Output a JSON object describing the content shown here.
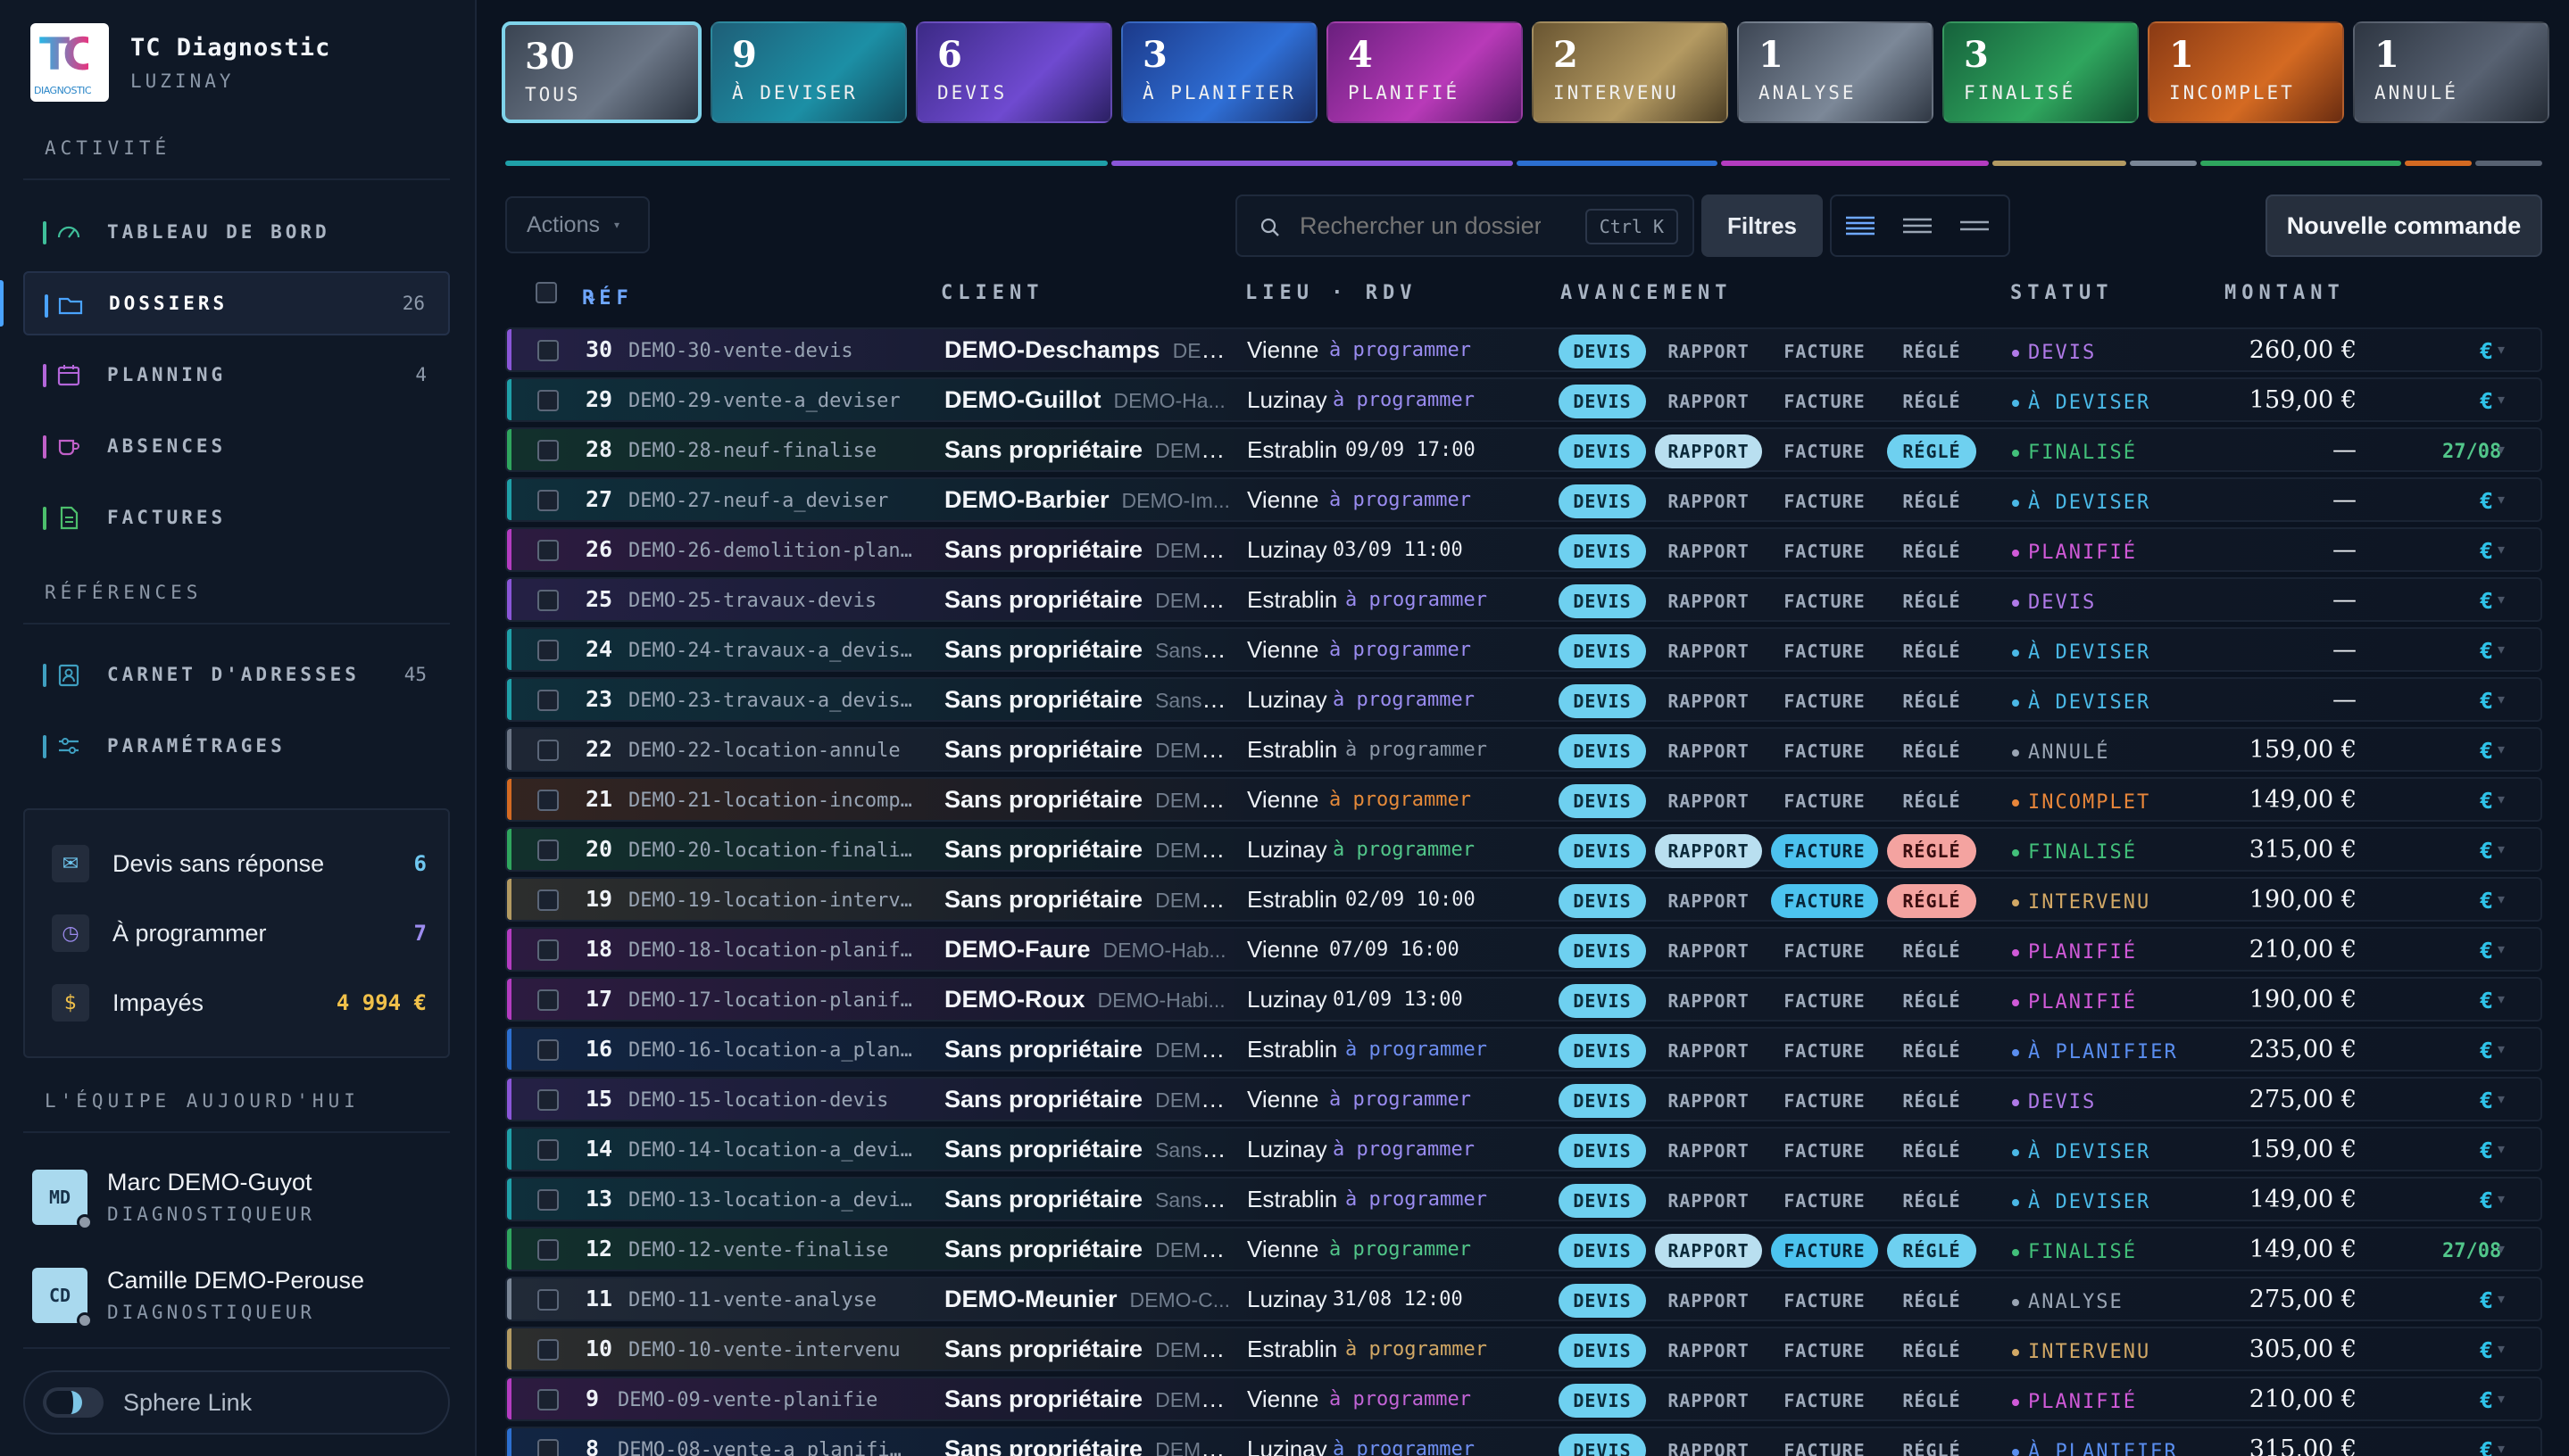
{
  "brand": {
    "title": "TC Diagnostic",
    "city": "LUZINAY",
    "logo_text": "TC",
    "logo_sub": "DIAGNOSTIC"
  },
  "sidebar": {
    "section_activite": "ACTIVITÉ",
    "nav": [
      {
        "label": "TABLEAU DE BORD",
        "count": "",
        "color": "#3fbf9a",
        "icon": "gauge-icon"
      },
      {
        "label": "DOSSIERS",
        "count": "26",
        "color": "#4aa3ff",
        "icon": "folder-icon"
      },
      {
        "label": "PLANNING",
        "count": "4",
        "color": "#b366d9",
        "icon": "calendar-icon"
      },
      {
        "label": "ABSENCES",
        "count": "",
        "color": "#c060c8",
        "icon": "mug-icon"
      },
      {
        "label": "FACTURES",
        "count": "",
        "color": "#4cbf6c",
        "icon": "document-icon"
      }
    ],
    "section_refs": "RÉFÉRENCES",
    "refs": [
      {
        "label": "CARNET D'ADRESSES",
        "count": "45",
        "color": "#3f9fc0",
        "icon": "contacts-icon"
      },
      {
        "label": "PARAMÉTRAGES",
        "count": "",
        "color": "#3f9fc0",
        "icon": "sliders-icon"
      }
    ],
    "stats": [
      {
        "label": "Devis sans réponse",
        "value": "6",
        "color": "#6fc7f0",
        "icon": "mail-icon"
      },
      {
        "label": "À programmer",
        "value": "7",
        "color": "#9d8cf0",
        "icon": "clock-icon"
      },
      {
        "label": "Impayés",
        "value": "4 994 €",
        "color": "#f0c04a",
        "icon": "coin-icon"
      }
    ],
    "section_team": "L'ÉQUIPE AUJOURD'HUI",
    "team": [
      {
        "initials": "MD",
        "name": "Marc DEMO-Guyot",
        "role": "DIAGNOSTIQUEUR"
      },
      {
        "initials": "CD",
        "name": "Camille DEMO-Perouse",
        "role": "DIAGNOSTIQUEUR"
      }
    ],
    "sphere_label": "Sphere Link"
  },
  "cards": [
    {
      "count": "30",
      "label": "TOUS",
      "bg": "linear-gradient(135deg,#3a4452,#6b7686 60%,#2c3440)"
    },
    {
      "count": "9",
      "label": "À DEVISER",
      "bg": "linear-gradient(135deg,#1e5f78,#1c8fa5 60%,#124a5c)"
    },
    {
      "count": "6",
      "label": "DEVIS",
      "bg": "linear-gradient(135deg,#3c2a86,#6f4ad0 60%,#2b2063)"
    },
    {
      "count": "3",
      "label": "À PLANIFIER",
      "bg": "linear-gradient(135deg,#1c3a8a,#2f6fd6 60%,#1a2e66)"
    },
    {
      "count": "4",
      "label": "PLANIFIÉ",
      "bg": "linear-gradient(135deg,#6a1f7e,#b83ab8 60%,#541a66)"
    },
    {
      "count": "2",
      "label": "INTERVENU",
      "bg": "linear-gradient(135deg,#6a5632,#b49a62 60%,#4c3e24)"
    },
    {
      "count": "1",
      "label": "ANALYSE",
      "bg": "linear-gradient(135deg,#3d4654,#7c8898 60%,#2f3743)"
    },
    {
      "count": "3",
      "label": "FINALISÉ",
      "bg": "linear-gradient(135deg,#16623c,#2fa65e 60%,#124e30)"
    },
    {
      "count": "1",
      "label": "INCOMPLET",
      "bg": "linear-gradient(135deg,#8a3a14,#d46a22 60%,#6a2c10)"
    },
    {
      "count": "1",
      "label": "ANNULÉ",
      "bg": "linear-gradient(135deg,#2e3642,#586272 60%,#242b35)"
    }
  ],
  "progress": [
    {
      "w": 9,
      "color": "#1fa0a8"
    },
    {
      "w": 6,
      "color": "#8a56d8"
    },
    {
      "w": 3,
      "color": "#2c6fd0"
    },
    {
      "w": 4,
      "color": "#b43cc0"
    },
    {
      "w": 2,
      "color": "#b39a62"
    },
    {
      "w": 1,
      "color": "#7a8696"
    },
    {
      "w": 3,
      "color": "#2fa65e"
    },
    {
      "w": 1,
      "color": "#d46a22"
    },
    {
      "w": 1,
      "color": "#586272"
    }
  ],
  "toolbar": {
    "actions": "Actions",
    "search_placeholder": "Rechercher un dossier",
    "shortcut": "Ctrl K",
    "filters": "Filtres",
    "new_order": "Nouvelle commande"
  },
  "columns": {
    "ref": "RÉF",
    "client": "CLIENT",
    "lieu": "LIEU · RDV",
    "avancement": "AVANCEMENT",
    "statut": "STATUT",
    "montant": "MONTANT"
  },
  "pill_labels": {
    "devis": "DEVIS",
    "rapport": "RAPPORT",
    "facture": "FACTURE",
    "regle": "RÉGLÉ"
  },
  "rows": [
    {
      "n": "30",
      "ref": "DEMO-30-vente-devis",
      "client": "DEMO-Deschamps",
      "sub": "DEMO-...",
      "lieu": "Vienne",
      "rdv": "à programmer",
      "rdvc": "#9a8cf0",
      "st": "DEVIS",
      "stc": "#b07ae8",
      "amt": "260,00 €",
      "extra": "€",
      "rapport": 0,
      "facture": 0,
      "regle": 0,
      "acc": "#8a56d8"
    },
    {
      "n": "29",
      "ref": "DEMO-29-vente-a_deviser",
      "client": "DEMO-Guillot",
      "sub": "DEMO-Ha...",
      "lieu": "Luzinay",
      "rdv": "à programmer",
      "rdvc": "#9a8cf0",
      "st": "À DEVISER",
      "stc": "#4ab8e6",
      "amt": "159,00 €",
      "extra": "€",
      "rapport": 0,
      "facture": 0,
      "regle": 0,
      "acc": "#1fa0a8"
    },
    {
      "n": "28",
      "ref": "DEMO-28-neuf-finalise",
      "client": "Sans propriétaire",
      "sub": "DEMO-...",
      "lieu": "Estrablin",
      "rdv": "09/09 17:00",
      "rdvc": "#e9edf3",
      "st": "FINALISÉ",
      "stc": "#42c07a",
      "amt": "—",
      "extra": "27/08",
      "rapport": 1,
      "facture": 0,
      "regle": 1,
      "acc": "#2fa65e"
    },
    {
      "n": "27",
      "ref": "DEMO-27-neuf-a_deviser",
      "client": "DEMO-Barbier",
      "sub": "DEMO-Im...",
      "lieu": "Vienne",
      "rdv": "à programmer",
      "rdvc": "#9a8cf0",
      "st": "À DEVISER",
      "stc": "#4ab8e6",
      "amt": "—",
      "extra": "€",
      "rapport": 0,
      "facture": 0,
      "regle": 0,
      "acc": "#1fa0a8"
    },
    {
      "n": "26",
      "ref": "DEMO-26-demolition-planifie",
      "client": "Sans propriétaire",
      "sub": "DEMO-...",
      "lieu": "Luzinay",
      "rdv": "03/09 11:00",
      "rdvc": "#e9edf3",
      "st": "PLANIFIÉ",
      "stc": "#d05ad8",
      "amt": "—",
      "extra": "€",
      "rapport": 0,
      "facture": 0,
      "regle": 0,
      "acc": "#b43cc0"
    },
    {
      "n": "25",
      "ref": "DEMO-25-travaux-devis",
      "client": "Sans propriétaire",
      "sub": "DEMO-...",
      "lieu": "Estrablin",
      "rdv": "à programmer",
      "rdvc": "#9a8cf0",
      "st": "DEVIS",
      "stc": "#b07ae8",
      "amt": "—",
      "extra": "€",
      "rapport": 0,
      "facture": 0,
      "regle": 0,
      "acc": "#8a56d8"
    },
    {
      "n": "24",
      "ref": "DEMO-24-travaux-a_deviser",
      "client": "Sans propriétaire",
      "sub": "Sans pr...",
      "lieu": "Vienne",
      "rdv": "à programmer",
      "rdvc": "#9a8cf0",
      "st": "À DEVISER",
      "stc": "#4ab8e6",
      "amt": "—",
      "extra": "€",
      "rapport": 0,
      "facture": 0,
      "regle": 0,
      "acc": "#1fa0a8"
    },
    {
      "n": "23",
      "ref": "DEMO-23-travaux-a_deviser",
      "client": "Sans propriétaire",
      "sub": "Sans pr...",
      "lieu": "Luzinay",
      "rdv": "à programmer",
      "rdvc": "#9a8cf0",
      "st": "À DEVISER",
      "stc": "#4ab8e6",
      "amt": "—",
      "extra": "€",
      "rapport": 0,
      "facture": 0,
      "regle": 0,
      "acc": "#1fa0a8"
    },
    {
      "n": "22",
      "ref": "DEMO-22-location-annule",
      "client": "Sans propriétaire",
      "sub": "DEMO-...",
      "lieu": "Estrablin",
      "rdv": "à programmer",
      "rdvc": "#8d98a8",
      "st": "ANNULÉ",
      "stc": "#9aa5b4",
      "amt": "159,00 €",
      "extra": "€",
      "rapport": 0,
      "facture": 0,
      "regle": 0,
      "acc": "#6a7484"
    },
    {
      "n": "21",
      "ref": "DEMO-21-location-incomplet",
      "client": "Sans propriétaire",
      "sub": "DEMO-...",
      "lieu": "Vienne",
      "rdv": "à programmer",
      "rdvc": "#e58a3a",
      "st": "INCOMPLET",
      "stc": "#e8863a",
      "amt": "149,00 €",
      "extra": "€",
      "rapport": 0,
      "facture": 0,
      "regle": 0,
      "acc": "#d46a22"
    },
    {
      "n": "20",
      "ref": "DEMO-20-location-finalise",
      "client": "Sans propriétaire",
      "sub": "DEMO-...",
      "lieu": "Luzinay",
      "rdv": "à programmer",
      "rdvc": "#52c68a",
      "st": "FINALISÉ",
      "stc": "#42c07a",
      "amt": "315,00 €",
      "extra": "€",
      "rapport": 1,
      "facture": 1,
      "regle": 2,
      "acc": "#2fa65e"
    },
    {
      "n": "19",
      "ref": "DEMO-19-location-intervenu",
      "client": "Sans propriétaire",
      "sub": "DEMO-...",
      "lieu": "Estrablin",
      "rdv": "02/09 10:00",
      "rdvc": "#e9edf3",
      "st": "INTERVENU",
      "stc": "#d2a865",
      "amt": "190,00 €",
      "extra": "€",
      "rapport": 0,
      "facture": 1,
      "regle": 2,
      "acc": "#b39a62"
    },
    {
      "n": "18",
      "ref": "DEMO-18-location-planifie",
      "client": "DEMO-Faure",
      "sub": "DEMO-Hab...",
      "lieu": "Vienne",
      "rdv": "07/09 16:00",
      "rdvc": "#e9edf3",
      "st": "PLANIFIÉ",
      "stc": "#d05ad8",
      "amt": "210,00 €",
      "extra": "€",
      "rapport": 0,
      "facture": 0,
      "regle": 0,
      "acc": "#b43cc0"
    },
    {
      "n": "17",
      "ref": "DEMO-17-location-planifie",
      "client": "DEMO-Roux",
      "sub": "DEMO-Habi...",
      "lieu": "Luzinay",
      "rdv": "01/09 13:00",
      "rdvc": "#e9edf3",
      "st": "PLANIFIÉ",
      "stc": "#d05ad8",
      "amt": "190,00 €",
      "extra": "€",
      "rapport": 0,
      "facture": 0,
      "regle": 0,
      "acc": "#b43cc0"
    },
    {
      "n": "16",
      "ref": "DEMO-16-location-a_planifier",
      "client": "Sans propriétaire",
      "sub": "DEMO-...",
      "lieu": "Estrablin",
      "rdv": "à programmer",
      "rdvc": "#6e8ef0",
      "st": "À PLANIFIER",
      "stc": "#5a8ef0",
      "amt": "235,00 €",
      "extra": "€",
      "rapport": 0,
      "facture": 0,
      "regle": 0,
      "acc": "#2c6fd0"
    },
    {
      "n": "15",
      "ref": "DEMO-15-location-devis",
      "client": "Sans propriétaire",
      "sub": "DEMO-...",
      "lieu": "Vienne",
      "rdv": "à programmer",
      "rdvc": "#9a8cf0",
      "st": "DEVIS",
      "stc": "#b07ae8",
      "amt": "275,00 €",
      "extra": "€",
      "rapport": 0,
      "facture": 0,
      "regle": 0,
      "acc": "#8a56d8"
    },
    {
      "n": "14",
      "ref": "DEMO-14-location-a_deviser",
      "client": "Sans propriétaire",
      "sub": "Sans pr...",
      "lieu": "Luzinay",
      "rdv": "à programmer",
      "rdvc": "#9a8cf0",
      "st": "À DEVISER",
      "stc": "#4ab8e6",
      "amt": "159,00 €",
      "extra": "€",
      "rapport": 0,
      "facture": 0,
      "regle": 0,
      "acc": "#1fa0a8"
    },
    {
      "n": "13",
      "ref": "DEMO-13-location-a_deviser",
      "client": "Sans propriétaire",
      "sub": "Sans pr...",
      "lieu": "Estrablin",
      "rdv": "à programmer",
      "rdvc": "#9a8cf0",
      "st": "À DEVISER",
      "stc": "#4ab8e6",
      "amt": "149,00 €",
      "extra": "€",
      "rapport": 0,
      "facture": 0,
      "regle": 0,
      "acc": "#1fa0a8"
    },
    {
      "n": "12",
      "ref": "DEMO-12-vente-finalise",
      "client": "Sans propriétaire",
      "sub": "DEMO-...",
      "lieu": "Vienne",
      "rdv": "à programmer",
      "rdvc": "#52c68a",
      "st": "FINALISÉ",
      "stc": "#42c07a",
      "amt": "149,00 €",
      "extra": "27/08",
      "rapport": 1,
      "facture": 1,
      "regle": 1,
      "acc": "#2fa65e"
    },
    {
      "n": "11",
      "ref": "DEMO-11-vente-analyse",
      "client": "DEMO-Meunier",
      "sub": "DEMO-C...",
      "lieu": "Luzinay",
      "rdv": "31/08 12:00",
      "rdvc": "#e9edf3",
      "st": "ANALYSE",
      "stc": "#9aa5b4",
      "amt": "275,00 €",
      "extra": "€",
      "rapport": 0,
      "facture": 0,
      "regle": 0,
      "acc": "#7a8696"
    },
    {
      "n": "10",
      "ref": "DEMO-10-vente-intervenu",
      "client": "Sans propriétaire",
      "sub": "DEMO-...",
      "lieu": "Estrablin",
      "rdv": "à programmer",
      "rdvc": "#d2a865",
      "st": "INTERVENU",
      "stc": "#d2a865",
      "amt": "305,00 €",
      "extra": "€",
      "rapport": 0,
      "facture": 0,
      "regle": 0,
      "acc": "#b39a62"
    },
    {
      "n": "9",
      "ref": "DEMO-09-vente-planifie",
      "client": "Sans propriétaire",
      "sub": "DEMO-...",
      "lieu": "Vienne",
      "rdv": "à programmer",
      "rdvc": "#c264d6",
      "st": "PLANIFIÉ",
      "stc": "#d05ad8",
      "amt": "210,00 €",
      "extra": "€",
      "rapport": 0,
      "facture": 0,
      "regle": 0,
      "acc": "#b43cc0"
    },
    {
      "n": "8",
      "ref": "DEMO-08-vente-a_planifier",
      "client": "Sans propriétaire",
      "sub": "DEMO-...",
      "lieu": "Luzinay",
      "rdv": "à programmer",
      "rdvc": "#6e8ef0",
      "st": "À PLANIFIER",
      "stc": "#5a8ef0",
      "amt": "315,00 €",
      "extra": "€",
      "rapport": 0,
      "facture": 0,
      "regle": 0,
      "acc": "#2c6fd0"
    }
  ]
}
